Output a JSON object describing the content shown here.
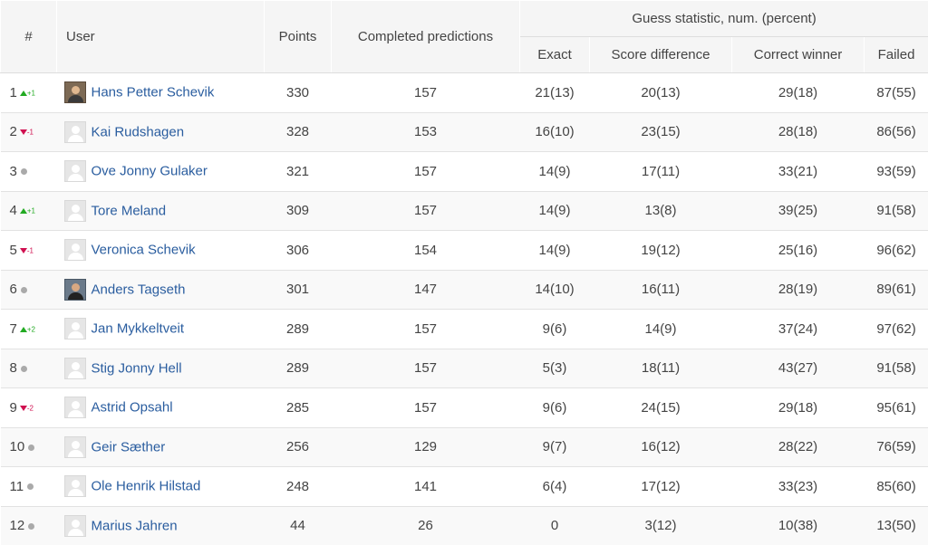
{
  "header": {
    "rank": "#",
    "user": "User",
    "points": "Points",
    "completed": "Completed predictions",
    "guess_group": "Guess statistic, num. (percent)",
    "exact": "Exact",
    "score_diff": "Score difference",
    "correct_winner": "Correct winner",
    "failed": "Failed"
  },
  "rows": [
    {
      "rank": "1",
      "trend": "up",
      "change": "+1",
      "avatar": "photo",
      "name": "Hans Petter Schevik",
      "points": "330",
      "completed": "157",
      "exact": "21(13)",
      "score_diff": "20(13)",
      "correct_winner": "29(18)",
      "failed": "87(55)"
    },
    {
      "rank": "2",
      "trend": "down",
      "change": "-1",
      "avatar": "default",
      "name": "Kai Rudshagen",
      "points": "328",
      "completed": "153",
      "exact": "16(10)",
      "score_diff": "23(15)",
      "correct_winner": "28(18)",
      "failed": "86(56)"
    },
    {
      "rank": "3",
      "trend": "same",
      "change": "",
      "avatar": "default",
      "name": "Ove Jonny Gulaker",
      "points": "321",
      "completed": "157",
      "exact": "14(9)",
      "score_diff": "17(11)",
      "correct_winner": "33(21)",
      "failed": "93(59)"
    },
    {
      "rank": "4",
      "trend": "up",
      "change": "+1",
      "avatar": "default",
      "name": "Tore Meland",
      "points": "309",
      "completed": "157",
      "exact": "14(9)",
      "score_diff": "13(8)",
      "correct_winner": "39(25)",
      "failed": "91(58)"
    },
    {
      "rank": "5",
      "trend": "down",
      "change": "-1",
      "avatar": "default",
      "name": "Veronica Schevik",
      "points": "306",
      "completed": "154",
      "exact": "14(9)",
      "score_diff": "19(12)",
      "correct_winner": "25(16)",
      "failed": "96(62)"
    },
    {
      "rank": "6",
      "trend": "same",
      "change": "",
      "avatar": "photo2",
      "name": "Anders Tagseth",
      "points": "301",
      "completed": "147",
      "exact": "14(10)",
      "score_diff": "16(11)",
      "correct_winner": "28(19)",
      "failed": "89(61)"
    },
    {
      "rank": "7",
      "trend": "up",
      "change": "+2",
      "avatar": "default",
      "name": "Jan Mykkeltveit",
      "points": "289",
      "completed": "157",
      "exact": "9(6)",
      "score_diff": "14(9)",
      "correct_winner": "37(24)",
      "failed": "97(62)"
    },
    {
      "rank": "8",
      "trend": "same",
      "change": "",
      "avatar": "default",
      "name": "Stig Jonny Hell",
      "points": "289",
      "completed": "157",
      "exact": "5(3)",
      "score_diff": "18(11)",
      "correct_winner": "43(27)",
      "failed": "91(58)"
    },
    {
      "rank": "9",
      "trend": "down",
      "change": "-2",
      "avatar": "default",
      "name": "Astrid Opsahl",
      "points": "285",
      "completed": "157",
      "exact": "9(6)",
      "score_diff": "24(15)",
      "correct_winner": "29(18)",
      "failed": "95(61)"
    },
    {
      "rank": "10",
      "trend": "same",
      "change": "",
      "avatar": "default",
      "name": "Geir Sæther",
      "points": "256",
      "completed": "129",
      "exact": "9(7)",
      "score_diff": "16(12)",
      "correct_winner": "28(22)",
      "failed": "76(59)"
    },
    {
      "rank": "11",
      "trend": "same",
      "change": "",
      "avatar": "default",
      "name": "Ole Henrik Hilstad",
      "points": "248",
      "completed": "141",
      "exact": "6(4)",
      "score_diff": "17(12)",
      "correct_winner": "33(23)",
      "failed": "85(60)"
    },
    {
      "rank": "12",
      "trend": "same",
      "change": "",
      "avatar": "default",
      "name": "Marius Jahren",
      "points": "44",
      "completed": "26",
      "exact": "0",
      "score_diff": "3(12)",
      "correct_winner": "10(38)",
      "failed": "13(50)"
    }
  ],
  "colors": {
    "up": "#22aa22",
    "down": "#d01050",
    "same": "#aaaaaa",
    "link": "#2a5d9f"
  }
}
